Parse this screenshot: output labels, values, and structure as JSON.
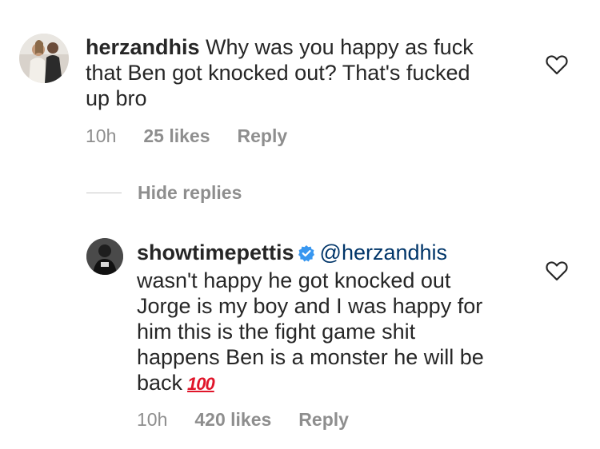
{
  "comment1": {
    "username": "herzandhis",
    "text_line1": "Why was you happy as fuck",
    "text_line2": "that Ben got knocked out? That's fucked",
    "text_line3": "up bro",
    "time": "10h",
    "likes": "25 likes",
    "reply": "Reply",
    "icons": {
      "like": "heart-outline-icon"
    }
  },
  "replies_toggle": {
    "label": "Hide replies"
  },
  "comment2": {
    "username": "showtimepettis",
    "verified": "verified-badge-icon",
    "mention": "@herzandhis",
    "text_line1": "wasn't happy he got knocked out",
    "text_line2": "Jorge is my boy and I was happy for",
    "text_line3": "him this is the fight game shit",
    "text_line4": "happens Ben is a monster he will be",
    "text_line5": "back",
    "emoji": "100",
    "time": "10h",
    "likes": "420 likes",
    "reply": "Reply",
    "icons": {
      "like": "heart-outline-icon"
    }
  },
  "colors": {
    "text": "#262626",
    "muted": "#8e8e8e",
    "verified": "#3897f0",
    "emoji": "#e0152a"
  }
}
